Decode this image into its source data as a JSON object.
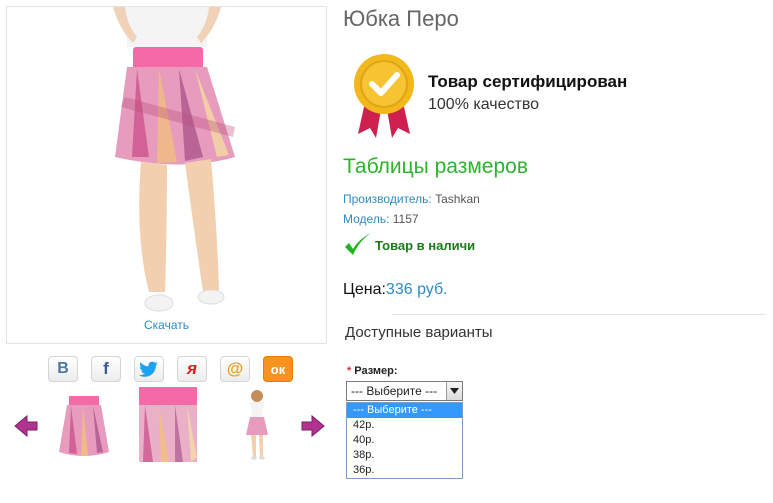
{
  "product": {
    "title": "Юбка Перо",
    "download_label": "Скачать",
    "certified_title": "Товар сертифицирован",
    "certified_sub": "100% качество",
    "size_tables_label": "Таблицы размеров",
    "manufacturer_label": "Производитель:",
    "manufacturer": "Tashkan",
    "model_label": "Модель:",
    "model": "1157",
    "stock_label": "Товар в наличи",
    "price_label": "Цена:",
    "price_value": "336 руб.",
    "variants_title": "Доступные варианты"
  },
  "options": {
    "size_label": "Размер:",
    "required_mark": "*",
    "selected": "--- Выберите ---",
    "dropdown": [
      "--- Выберите ---",
      "42р.",
      "40р.",
      "38р.",
      "36р."
    ]
  },
  "share": [
    {
      "name": "vk-share-button",
      "glyph": "В",
      "color": "#4a76a8"
    },
    {
      "name": "facebook-share-button",
      "glyph": "f",
      "color": "#3b5998"
    },
    {
      "name": "twitter-share-button",
      "glyph": "twitter",
      "color": "#1da1f2"
    },
    {
      "name": "yaru-share-button",
      "glyph": "я",
      "color": "#e02020"
    },
    {
      "name": "mailru-share-button",
      "glyph": "@",
      "color": "#f29c1f"
    },
    {
      "name": "odnoklassniki-share-button",
      "glyph": "ок",
      "color": "#ee8208"
    }
  ],
  "colors": {
    "accent_blue": "#2e8bc0",
    "green": "#2cb52c",
    "arrow_purple": "#b0338f",
    "badge_gold": "#f3b81c",
    "ribbon_red": "#cf1f4f"
  }
}
